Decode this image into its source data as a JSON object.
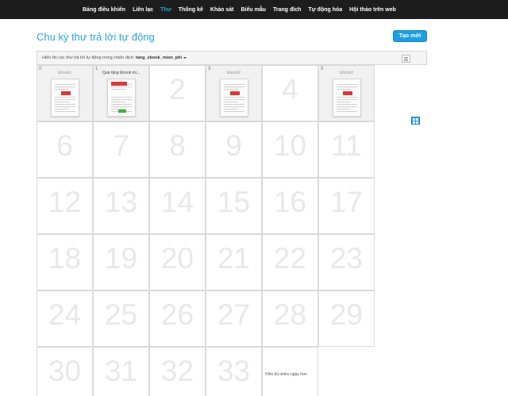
{
  "topnav": {
    "items": [
      {
        "label": "Bảng điều khiển",
        "active": false
      },
      {
        "label": "Liên lạc",
        "active": false
      },
      {
        "label": "Thư",
        "active": true
      },
      {
        "label": "Thống kê",
        "active": false
      },
      {
        "label": "Khảo sát",
        "active": false
      },
      {
        "label": "Biểu mẫu",
        "active": false
      },
      {
        "label": "Trang đích",
        "active": false
      },
      {
        "label": "Tự động hóa",
        "active": false
      },
      {
        "label": "Hội thảo trên web",
        "active": false
      }
    ],
    "accent_color": "#2aa5e0"
  },
  "page": {
    "title": "Chu kỳ thư trả lời tự động",
    "new_button": "Tạo mới"
  },
  "toolbar": {
    "caption": "Hiển thị các thư trả lời tự động trong chiến dịch:",
    "campaign": "tang_ebook_mien_phi",
    "views": [
      "list-view-icon",
      "grid-view-icon"
    ],
    "active_view": "grid"
  },
  "calendar": {
    "cells": [
      {
        "day": "0",
        "title": "Ebook1",
        "has_message": true
      },
      {
        "day": "1",
        "title": "Quà tặng Ebook mi...",
        "has_message": true
      },
      {
        "day": "2",
        "has_message": false
      },
      {
        "day": "3",
        "title": "Ebook2",
        "has_message": true
      },
      {
        "day": "4",
        "has_message": false
      },
      {
        "day": "5",
        "title": "Ebook3",
        "has_message": true
      },
      {
        "day": "6"
      },
      {
        "day": "7"
      },
      {
        "day": "8"
      },
      {
        "day": "9"
      },
      {
        "day": "10"
      },
      {
        "day": "11"
      },
      {
        "day": "12"
      },
      {
        "day": "13"
      },
      {
        "day": "14"
      },
      {
        "day": "15"
      },
      {
        "day": "16"
      },
      {
        "day": "17"
      },
      {
        "day": "18"
      },
      {
        "day": "19"
      },
      {
        "day": "20"
      },
      {
        "day": "21"
      },
      {
        "day": "22"
      },
      {
        "day": "23"
      },
      {
        "day": "24"
      },
      {
        "day": "25"
      },
      {
        "day": "26"
      },
      {
        "day": "27"
      },
      {
        "day": "28"
      },
      {
        "day": "29"
      },
      {
        "day": "30"
      },
      {
        "day": "31"
      },
      {
        "day": "32"
      },
      {
        "day": "33"
      }
    ],
    "more_link": "Hiển thị nhiều ngày hơn"
  }
}
